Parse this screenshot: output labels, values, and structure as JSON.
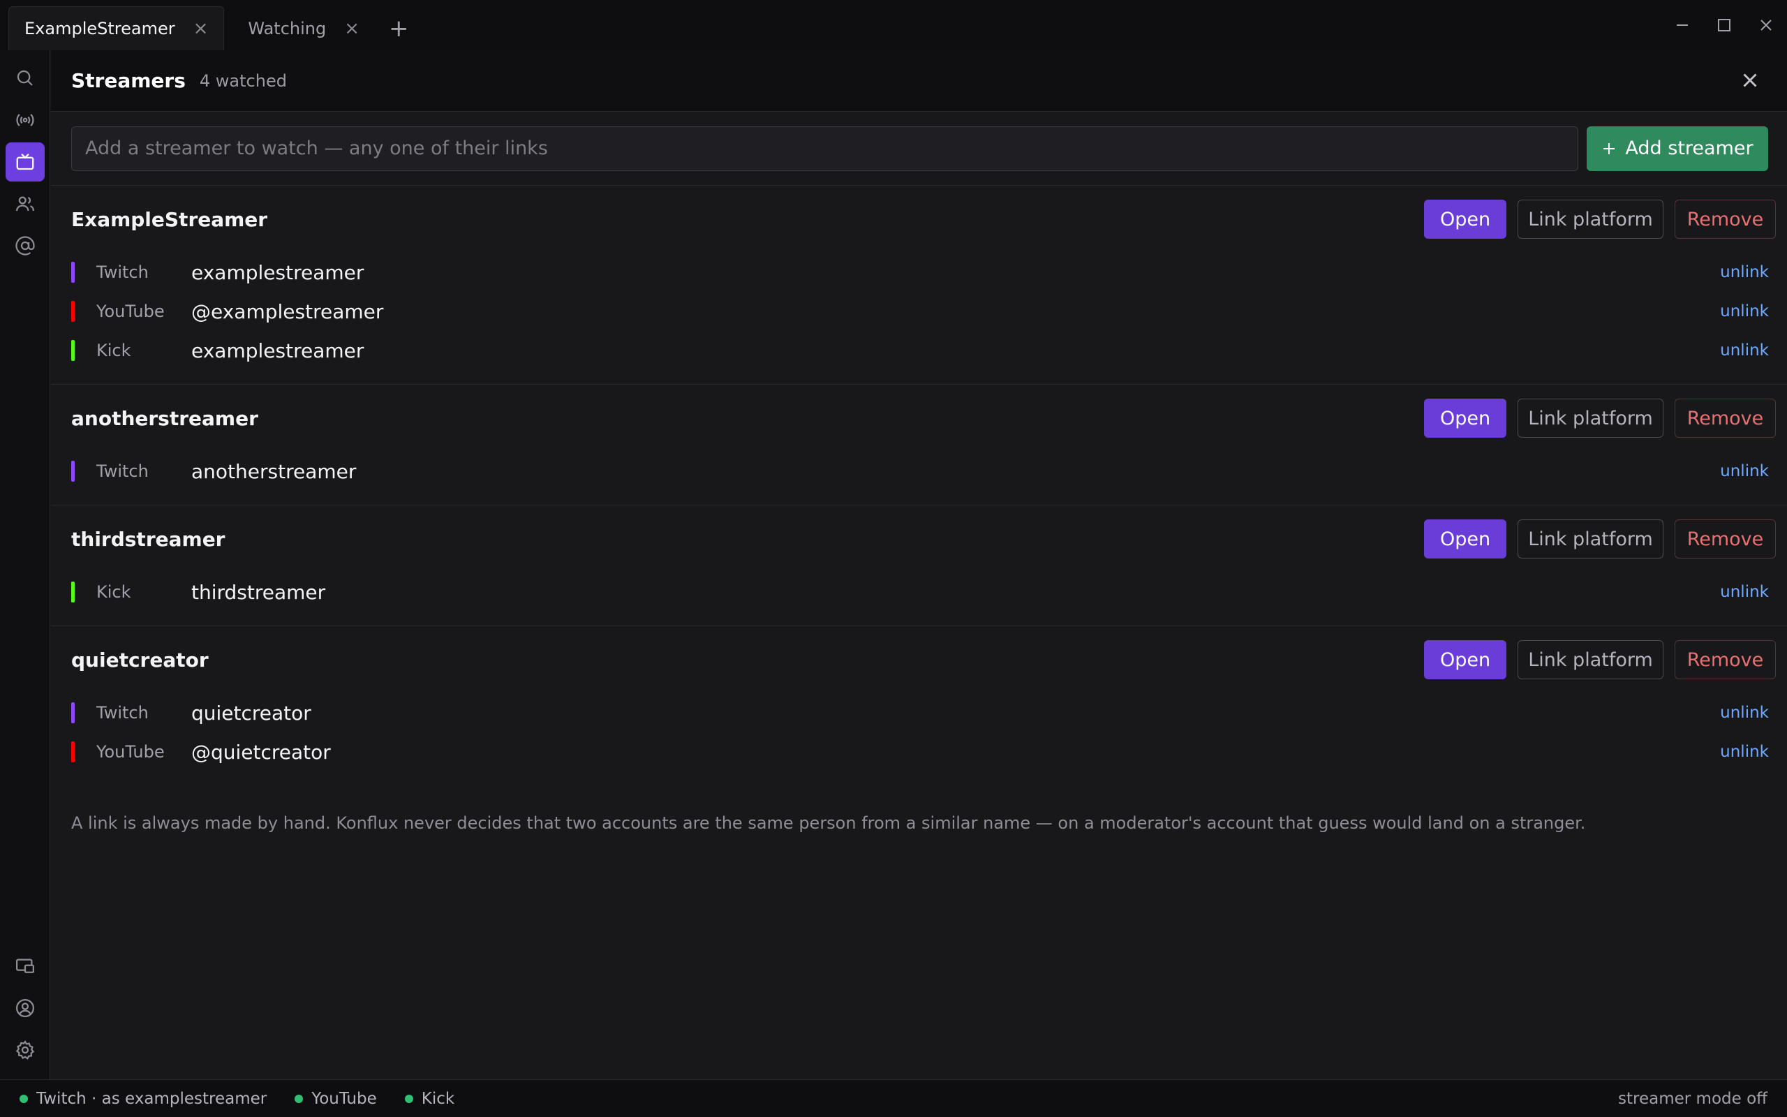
{
  "tabs": [
    {
      "label": "ExampleStreamer",
      "active": true
    },
    {
      "label": "Watching",
      "active": false
    }
  ],
  "rail": {
    "items": [
      {
        "name": "search-icon"
      },
      {
        "name": "broadcast-icon"
      },
      {
        "name": "tv-icon",
        "active": true
      },
      {
        "name": "users-icon"
      },
      {
        "name": "at-icon"
      }
    ],
    "bottom_items": [
      {
        "name": "cast-icon"
      },
      {
        "name": "account-icon"
      },
      {
        "name": "gear-icon"
      }
    ]
  },
  "header": {
    "title": "Streamers",
    "count": "4 watched"
  },
  "addbar": {
    "placeholder": "Add a streamer to watch — any one of their links",
    "button": "Add streamer"
  },
  "labels": {
    "open": "Open",
    "link_platform": "Link platform",
    "remove": "Remove",
    "unlink": "unlink"
  },
  "colors": {
    "twitch": "#9146ff",
    "youtube": "#ff0000",
    "kick": "#53fc18",
    "accent": "#6a3dd9",
    "add": "#2f8a5e"
  },
  "streamers": [
    {
      "name": "ExampleStreamer",
      "platforms": [
        {
          "platform": "Twitch",
          "handle": "examplestreamer"
        },
        {
          "platform": "YouTube",
          "handle": "@examplestreamer"
        },
        {
          "platform": "Kick",
          "handle": "examplestreamer"
        }
      ]
    },
    {
      "name": "anotherstreamer",
      "platforms": [
        {
          "platform": "Twitch",
          "handle": "anotherstreamer"
        }
      ]
    },
    {
      "name": "thirdstreamer",
      "platforms": [
        {
          "platform": "Kick",
          "handle": "thirdstreamer"
        }
      ]
    },
    {
      "name": "quietcreator",
      "platforms": [
        {
          "platform": "Twitch",
          "handle": "quietcreator"
        },
        {
          "platform": "YouTube",
          "handle": "@quietcreator"
        }
      ]
    }
  ],
  "note": "A link is always made by hand. Konflux never decides that two accounts are the same person from a similar name — on a moderator's account that guess would land on a stranger.",
  "status": {
    "items": [
      "Twitch · as examplestreamer",
      "YouTube",
      "Kick"
    ],
    "right": "streamer mode off"
  }
}
